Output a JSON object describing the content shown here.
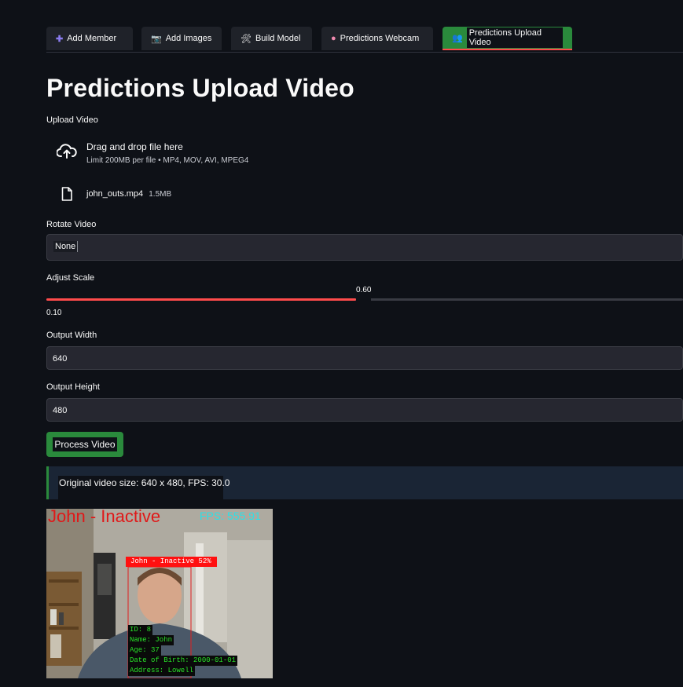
{
  "tabs": [
    {
      "label": "Add Member",
      "icon": "plus-icon",
      "active": false
    },
    {
      "label": "Add Images",
      "icon": "camera-icon",
      "active": false
    },
    {
      "label": "Build Model",
      "icon": "tools-icon",
      "active": false
    },
    {
      "label": "Predictions Webcam",
      "icon": "brain-icon",
      "active": false
    },
    {
      "label": "Predictions Upload Video",
      "icon": "people-icon",
      "active": true
    }
  ],
  "page_title": "Predictions Upload Video",
  "upload": {
    "label": "Upload Video",
    "dropzone_title": "Drag and drop file here",
    "dropzone_limit": "Limit 200MB per file • MP4, MOV, AVI, MPEG4",
    "file_name": "john_outs.mp4",
    "file_size": "1.5MB"
  },
  "rotate": {
    "label": "Rotate Video",
    "value": "None"
  },
  "scale": {
    "label": "Adjust Scale",
    "value": "0.60",
    "min": "0.10",
    "fraction": 0.555
  },
  "output_width": {
    "label": "Output Width",
    "value": "640"
  },
  "output_height": {
    "label": "Output Height",
    "value": "480"
  },
  "process_button": "Process Video",
  "info_text": "Original video size: 640 x 480, FPS: 30.0",
  "video_overlay": {
    "name_status": "John - Inactive",
    "fps": "FPS: 555.91",
    "box_label": "John - Inactive 52%",
    "details": [
      "ID: 8",
      "Name: John",
      "Age: 37",
      "Date of Birth: 2000-01-01",
      "Address: Lowell"
    ]
  },
  "colors": {
    "accent_green": "#2a8a3c",
    "accent_red": "#ff4b4b",
    "background": "#0e1117"
  }
}
